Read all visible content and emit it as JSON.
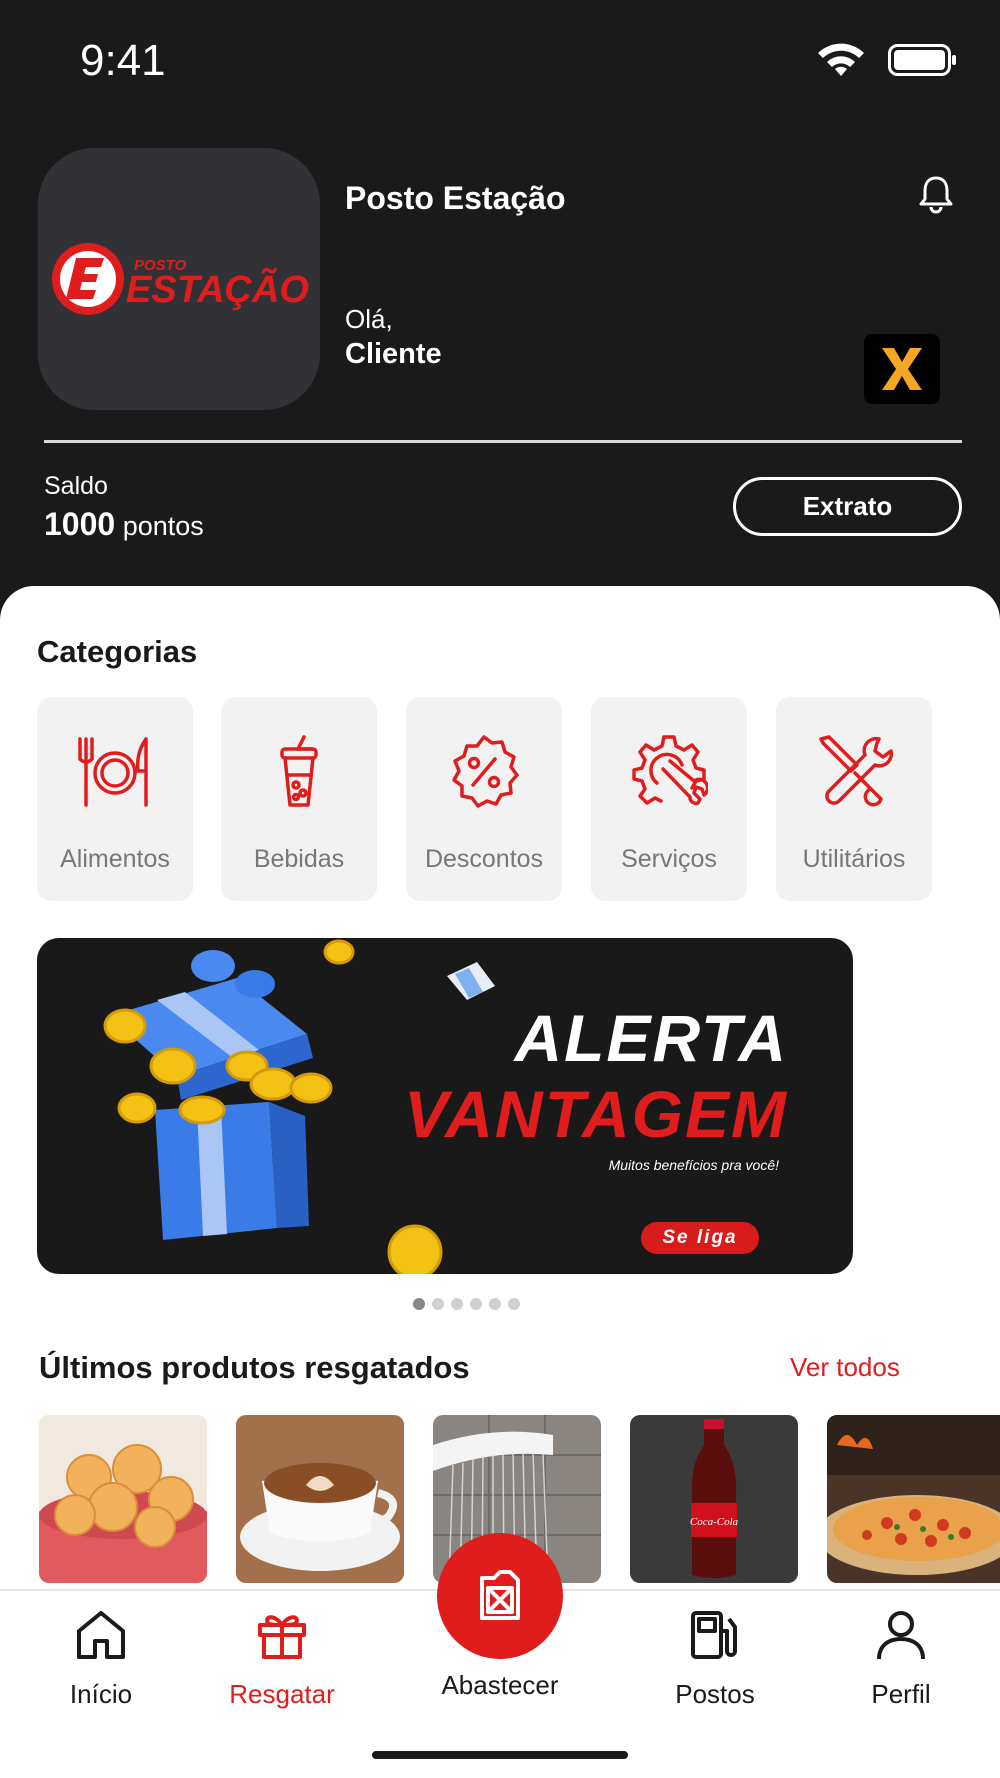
{
  "status_bar": {
    "time": "9:41"
  },
  "header": {
    "logo_text_small": "POSTO",
    "logo_text_big": "ESTAÇÃO",
    "store_name": "Posto Estação",
    "greeting": "Olá,",
    "user_name": "Cliente",
    "badge_letter": "X"
  },
  "balance": {
    "label": "Saldo",
    "points": "1000",
    "unit": "pontos",
    "extract_button": "Extrato"
  },
  "categories": {
    "title": "Categorias",
    "items": [
      {
        "label": "Alimentos",
        "icon": "utensils-icon"
      },
      {
        "label": "Bebidas",
        "icon": "drink-cup-icon"
      },
      {
        "label": "Descontos",
        "icon": "discount-badge-icon"
      },
      {
        "label": "Serviços",
        "icon": "gear-wrench-icon"
      },
      {
        "label": "Utilitários",
        "icon": "tools-icon"
      }
    ]
  },
  "banner": {
    "line1": "ALERTA",
    "line2": "VANTAGEM",
    "subtitle": "Muitos benefícios pra você!",
    "cta": "Se liga",
    "pages": 6,
    "active_page": 1
  },
  "recent_products": {
    "title": "Últimos produtos resgatados",
    "see_all": "Ver todos",
    "items": [
      {
        "icon": "cheese-bread-image"
      },
      {
        "icon": "cappuccino-image"
      },
      {
        "icon": "shower-image"
      },
      {
        "icon": "coca-cola-image",
        "label": "Coca-Cola"
      },
      {
        "icon": "pizza-image"
      }
    ]
  },
  "bottom_nav": {
    "home": "Início",
    "redeem": "Resgatar",
    "fuel": "Abastecer",
    "stations": "Postos",
    "profile": "Perfil"
  },
  "colors": {
    "accent": "#e01d1d",
    "header_bg": "#1a1a1b",
    "card_bg": "#f2f2f2",
    "badge_orange": "#f5a623"
  }
}
